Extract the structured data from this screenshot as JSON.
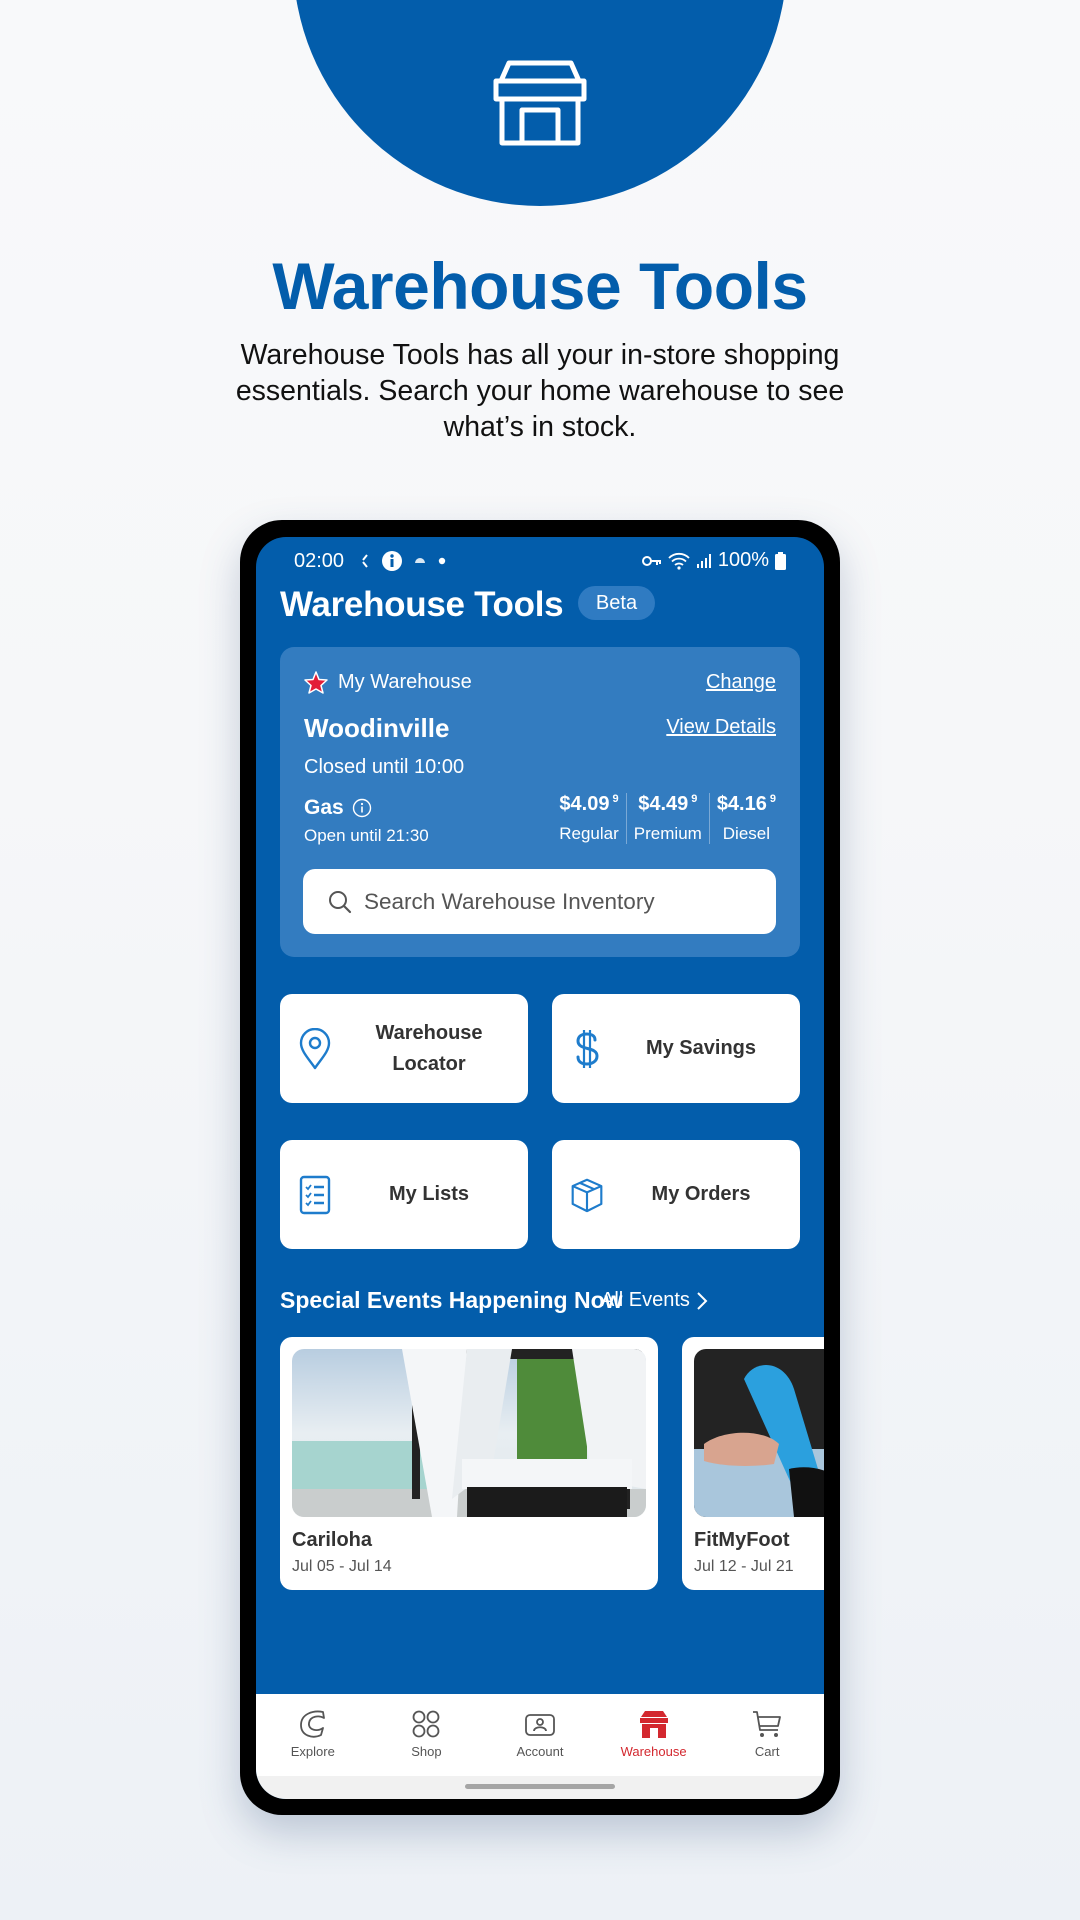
{
  "promo": {
    "title": "Warehouse Tools",
    "subtitle": "Warehouse Tools has all your in-store shopping essentials. Search your home warehouse to see what’s in stock.",
    "hero_icon": "warehouse-store-icon"
  },
  "status_bar": {
    "time": "02:00",
    "battery": "100%",
    "icons": [
      "sync-icon",
      "info-icon",
      "cloud-icon",
      "dot-icon",
      "vpn-key-icon",
      "wifi-icon",
      "signal-icon",
      "battery-icon"
    ]
  },
  "app": {
    "title": "Warehouse Tools",
    "badge": "Beta"
  },
  "warehouse_card": {
    "label": "My Warehouse",
    "change_link": "Change",
    "name": "Woodinville",
    "details_link": "View Details",
    "hours": "Closed until 10:00",
    "gas": {
      "title": "Gas",
      "hours": "Open until 21:30",
      "prices": [
        {
          "price": "$4.09",
          "fraction": "9",
          "type": "Regular"
        },
        {
          "price": "$4.49",
          "fraction": "9",
          "type": "Premium"
        },
        {
          "price": "$4.16",
          "fraction": "9",
          "type": "Diesel"
        }
      ]
    },
    "search_placeholder": "Search Warehouse Inventory"
  },
  "tiles": [
    {
      "label": "Warehouse Locator",
      "line1": "Warehouse",
      "line2": "Locator",
      "icon": "location-pin-icon"
    },
    {
      "label": "My Savings",
      "icon": "dollar-icon"
    },
    {
      "label": "My Lists",
      "icon": "checklist-icon"
    },
    {
      "label": "My Orders",
      "icon": "box-icon"
    }
  ],
  "events": {
    "title": "Special Events Happening Now",
    "all_link": "All Events",
    "items": [
      {
        "name": "Cariloha",
        "dates": "Jul 05 - Jul 14"
      },
      {
        "name": "FitMyFoot",
        "dates": "Jul 12 - Jul 21"
      }
    ]
  },
  "bottom_nav": {
    "items": [
      {
        "label": "Explore",
        "icon": "explore-c-icon",
        "active": false
      },
      {
        "label": "Shop",
        "icon": "grid-circles-icon",
        "active": false
      },
      {
        "label": "Account",
        "icon": "account-card-icon",
        "active": false
      },
      {
        "label": "Warehouse",
        "icon": "warehouse-icon",
        "active": true
      },
      {
        "label": "Cart",
        "icon": "cart-icon",
        "active": false
      }
    ]
  },
  "colors": {
    "brand_blue": "#035dab",
    "card_blue": "#337cc0",
    "active_red": "#d3282f"
  }
}
